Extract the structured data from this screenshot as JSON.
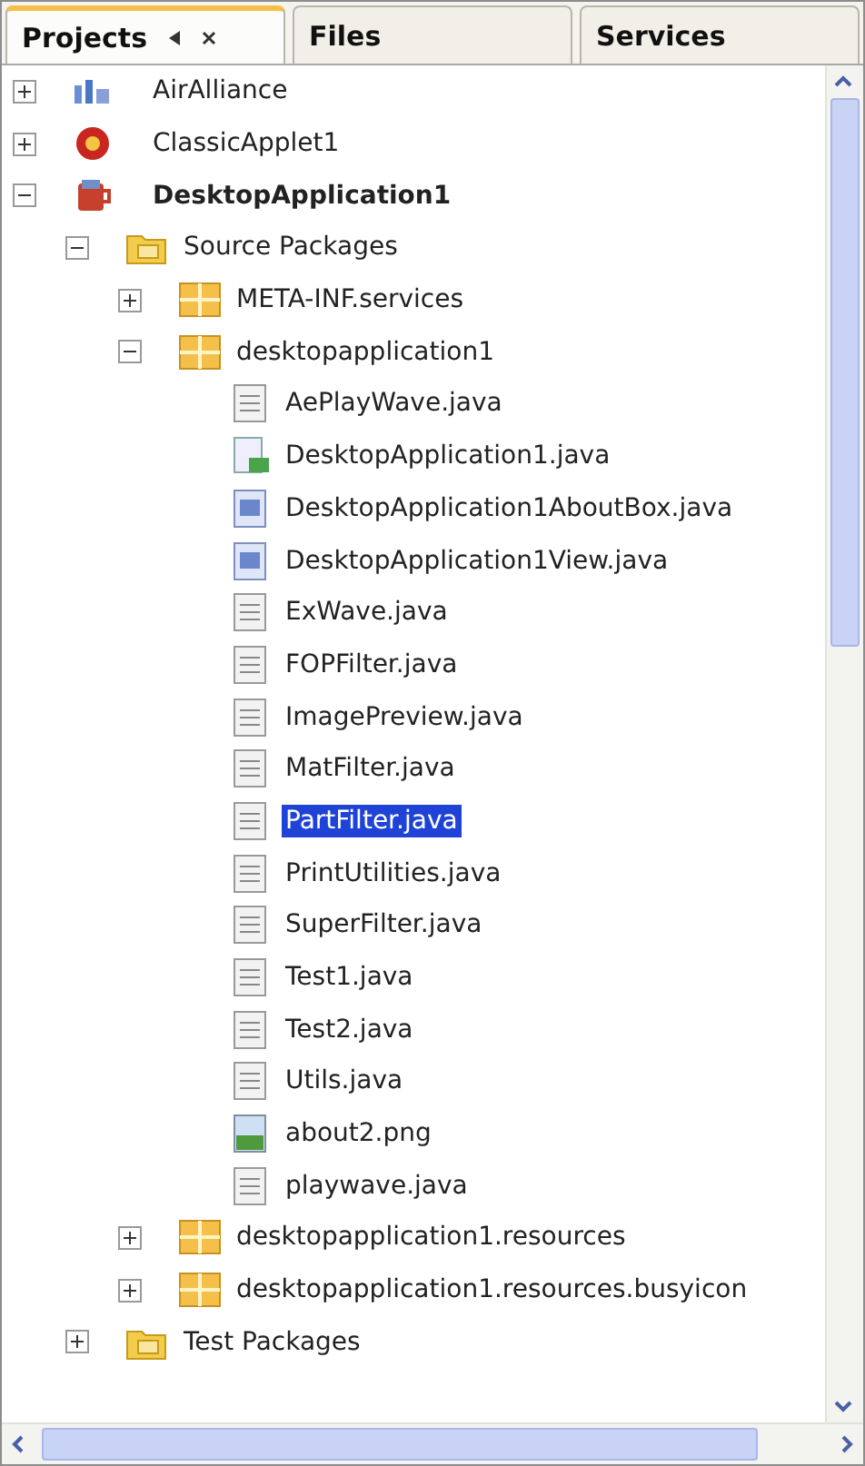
{
  "tabs": [
    {
      "label": "Projects",
      "selected": true
    },
    {
      "label": "Files",
      "selected": false
    },
    {
      "label": "Services",
      "selected": false
    }
  ],
  "tree": [
    {
      "label": "AirAlliance",
      "kind": "web-project",
      "main": false,
      "expanded": false,
      "selected": false
    },
    {
      "label": "ClassicApplet1",
      "kind": "applet-project",
      "main": false,
      "expanded": false,
      "selected": false
    },
    {
      "label": "DesktopApplication1",
      "kind": "desktop-project",
      "main": true,
      "expanded": true,
      "selected": false,
      "children": [
        {
          "label": "Source Packages",
          "kind": "source-folder",
          "expanded": true,
          "selected": false,
          "children": [
            {
              "label": "META-INF.services",
              "kind": "package",
              "expanded": false,
              "selected": false
            },
            {
              "label": "desktopapplication1",
              "kind": "package",
              "expanded": true,
              "selected": false,
              "children": [
                {
                  "label": "AePlayWave.java",
                  "kind": "java",
                  "selected": false
                },
                {
                  "label": "DesktopApplication1.java",
                  "kind": "main-class",
                  "selected": false
                },
                {
                  "label": "DesktopApplication1AboutBox.java",
                  "kind": "form",
                  "selected": false
                },
                {
                  "label": "DesktopApplication1View.java",
                  "kind": "form",
                  "selected": false
                },
                {
                  "label": "ExWave.java",
                  "kind": "java",
                  "selected": false
                },
                {
                  "label": "FOPFilter.java",
                  "kind": "java",
                  "selected": false
                },
                {
                  "label": "ImagePreview.java",
                  "kind": "java",
                  "selected": false
                },
                {
                  "label": "MatFilter.java",
                  "kind": "java",
                  "selected": false
                },
                {
                  "label": "PartFilter.java",
                  "kind": "java",
                  "selected": true
                },
                {
                  "label": "PrintUtilities.java",
                  "kind": "java",
                  "selected": false
                },
                {
                  "label": "SuperFilter.java",
                  "kind": "java",
                  "selected": false
                },
                {
                  "label": "Test1.java",
                  "kind": "java",
                  "selected": false
                },
                {
                  "label": "Test2.java",
                  "kind": "java",
                  "selected": false
                },
                {
                  "label": "Utils.java",
                  "kind": "java",
                  "selected": false
                },
                {
                  "label": "about2.png",
                  "kind": "image",
                  "selected": false
                },
                {
                  "label": "playwave.java",
                  "kind": "java",
                  "selected": false
                }
              ]
            },
            {
              "label": "desktopapplication1.resources",
              "kind": "package",
              "expanded": false,
              "selected": false
            },
            {
              "label": "desktopapplication1.resources.busyicon",
              "kind": "package",
              "expanded": false,
              "selected": false
            }
          ]
        },
        {
          "label": "Test Packages",
          "kind": "source-folder",
          "expanded": false,
          "selected": false
        }
      ]
    }
  ]
}
